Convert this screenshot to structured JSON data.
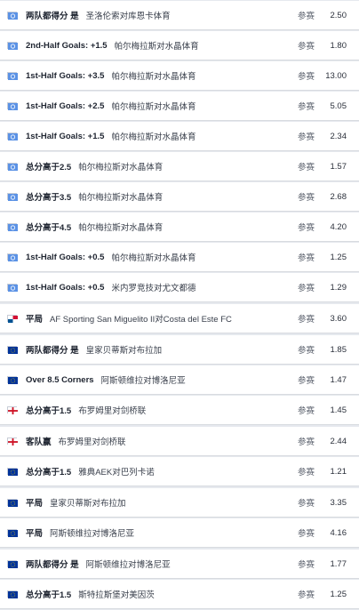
{
  "rows": [
    {
      "flag": "un",
      "market": "两队都得分 是",
      "event": "圣洛伦索对库恩卡体育",
      "label": "参赛",
      "odds": "2.50"
    },
    {
      "flag": "un",
      "market": "2nd-Half Goals: +1.5",
      "event": "帕尔梅拉斯对水晶体育",
      "label": "参赛",
      "odds": "1.80"
    },
    {
      "flag": "un",
      "market": "1st-Half Goals: +3.5",
      "event": "帕尔梅拉斯对水晶体育",
      "label": "参赛",
      "odds": "13.00"
    },
    {
      "flag": "un",
      "market": "1st-Half Goals: +2.5",
      "event": "帕尔梅拉斯对水晶体育",
      "label": "参赛",
      "odds": "5.05"
    },
    {
      "flag": "un",
      "market": "1st-Half Goals: +1.5",
      "event": "帕尔梅拉斯对水晶体育",
      "label": "参赛",
      "odds": "2.34"
    },
    {
      "flag": "un",
      "market": "总分高于2.5",
      "event": "帕尔梅拉斯对水晶体育",
      "label": "参赛",
      "odds": "1.57"
    },
    {
      "flag": "un",
      "market": "总分高于3.5",
      "event": "帕尔梅拉斯对水晶体育",
      "label": "参赛",
      "odds": "2.68"
    },
    {
      "flag": "un",
      "market": "总分高于4.5",
      "event": "帕尔梅拉斯对水晶体育",
      "label": "参赛",
      "odds": "4.20"
    },
    {
      "flag": "un",
      "market": "1st-Half Goals: +0.5",
      "event": "帕尔梅拉斯对水晶体育",
      "label": "参赛",
      "odds": "1.25"
    },
    {
      "flag": "un",
      "market": "1st-Half Goals: +0.5",
      "event": "米内罗竞技对尤文都德",
      "label": "参赛",
      "odds": "1.29"
    },
    {
      "flag": "pa",
      "market": "平局",
      "event": "AF Sporting San Miguelito II对Costa del Este FC",
      "label": "参赛",
      "odds": "3.60"
    },
    {
      "flag": "eu",
      "market": "两队都得分 是",
      "event": "皇家贝蒂斯对布拉加",
      "label": "参赛",
      "odds": "1.85"
    },
    {
      "flag": "eu",
      "market": "Over 8.5 Corners",
      "event": "阿斯顿维拉对博洛尼亚",
      "label": "参赛",
      "odds": "1.47"
    },
    {
      "flag": "en",
      "market": "总分高于1.5",
      "event": "布罗姆里对剑桥联",
      "label": "参赛",
      "odds": "1.45"
    },
    {
      "flag": "en",
      "market": "客队赢",
      "event": "布罗姆里对剑桥联",
      "label": "参赛",
      "odds": "2.44"
    },
    {
      "flag": "eu",
      "market": "总分高于1.5",
      "event": "雅典AEK对巴列卡诺",
      "label": "参赛",
      "odds": "1.21"
    },
    {
      "flag": "eu",
      "market": "平局",
      "event": "皇家贝蒂斯对布拉加",
      "label": "参赛",
      "odds": "3.35"
    },
    {
      "flag": "eu",
      "market": "平局",
      "event": "阿斯顿维拉对博洛尼亚",
      "label": "参赛",
      "odds": "4.16"
    },
    {
      "flag": "eu",
      "market": "两队都得分 是",
      "event": "阿斯顿维拉对博洛尼亚",
      "label": "参赛",
      "odds": "1.77"
    },
    {
      "flag": "eu",
      "market": "总分高于1.5",
      "event": "斯特拉斯堡对美因茨",
      "label": "参赛",
      "odds": "1.25"
    }
  ],
  "colors": {
    "un": "#5b92e5",
    "eu": "#003399",
    "en_cross": "#ce1124",
    "pa_red": "#d21034",
    "pa_blue": "#005293"
  }
}
